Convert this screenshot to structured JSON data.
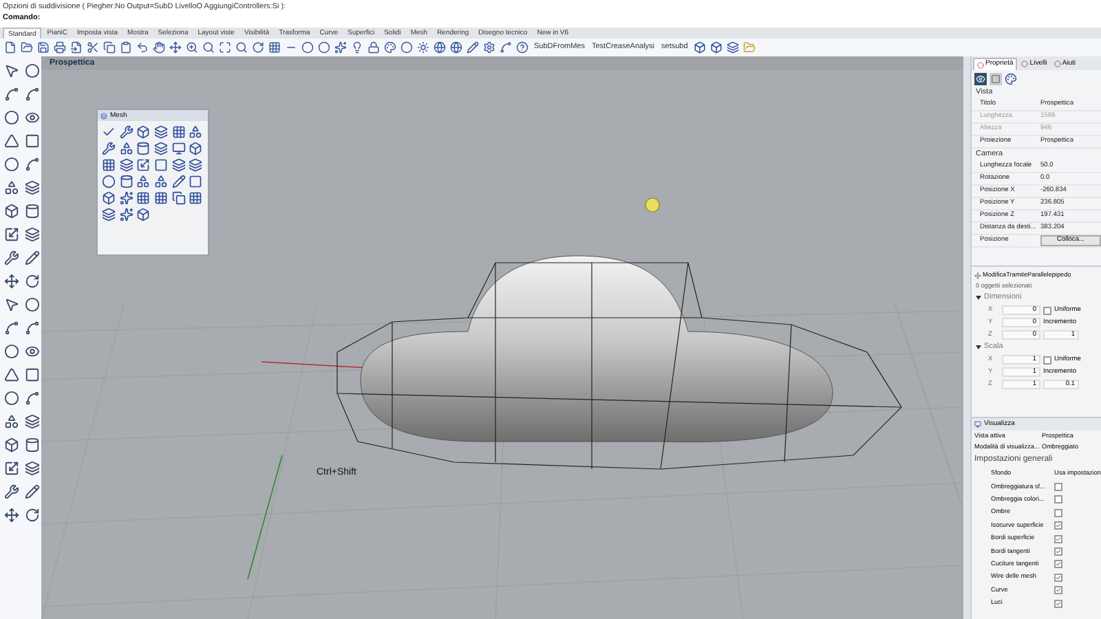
{
  "command_area": {
    "lines": [
      "Opzioni di suddivisione ( Piegher:No  Output=SubD  LivelloO  AggiungiControllers:Si ):"
    ],
    "prompt": "Comando:"
  },
  "toolbar_tabs": [
    {
      "label": "Standard",
      "selected": true
    },
    {
      "label": "PianiC",
      "selected": false
    },
    {
      "label": "Imposta vista",
      "selected": false
    },
    {
      "label": "Mostra",
      "selected": false
    },
    {
      "label": "Seleziona",
      "selected": false
    },
    {
      "label": "Layout viste",
      "selected": false
    },
    {
      "label": "Visibilità",
      "selected": false
    },
    {
      "label": "Trasforma",
      "selected": false
    },
    {
      "label": "Curve",
      "selected": false
    },
    {
      "label": "Superfici",
      "selected": false
    },
    {
      "label": "Solidi",
      "selected": false
    },
    {
      "label": "Mesh",
      "selected": false
    },
    {
      "label": "Rendering",
      "selected": false
    },
    {
      "label": "Disegno tecnico",
      "selected": false
    },
    {
      "label": "New in V6",
      "selected": false
    }
  ],
  "toolbar_buttons": [
    "SubDFromMes",
    "TestCreaseAnalysi",
    "setsubd"
  ],
  "viewport": {
    "title": "Prospettica",
    "caption": "Ctrl+Shift"
  },
  "mesh_panel": {
    "title": "Mesh"
  },
  "panel_tabs": [
    {
      "label": "Proprietà",
      "selected": true
    },
    {
      "label": "Livelli",
      "selected": false
    },
    {
      "label": "Aiuti",
      "selected": false
    }
  ],
  "properties": [
    {
      "title": "Vista",
      "rows": [
        {
          "label": "Titolo",
          "value": "Prospettica",
          "kind": "text",
          "disabled": false
        },
        {
          "label": "Lunghezza",
          "value": "1569",
          "kind": "text",
          "disabled": true
        },
        {
          "label": "Altezza",
          "value": "946",
          "kind": "text",
          "disabled": true
        },
        {
          "label": "Proiezione",
          "value": "Prospettica",
          "kind": "text",
          "disabled": false
        }
      ]
    },
    {
      "title": "Camera",
      "rows": [
        {
          "label": "Lunghezza focale",
          "value": "50.0",
          "kind": "text",
          "disabled": false
        },
        {
          "label": "Rotazione",
          "value": "0.0",
          "kind": "text",
          "disabled": false
        },
        {
          "label": "Posizione X",
          "value": "-260.834",
          "kind": "text",
          "disabled": false
        },
        {
          "label": "Posizione Y",
          "value": "236.805",
          "kind": "text",
          "disabled": false
        },
        {
          "label": "Posizione Z",
          "value": "197.431",
          "kind": "text",
          "disabled": false
        },
        {
          "label": "Distanza da desti...",
          "value": "383.204",
          "kind": "text",
          "disabled": false
        },
        {
          "label": "Posizione",
          "value": "Colloca...",
          "kind": "button",
          "disabled": false
        }
      ]
    }
  ],
  "box_edit": {
    "title": "ModificaTramiteParallelepipedo",
    "status": "0 oggetti selezionati",
    "groups": [
      {
        "title": "Dimensioni",
        "expanded": true,
        "rows": [
          {
            "axis": "X",
            "value": "0",
            "kind": "checkbox",
            "extra": "Uniforme",
            "checked": false
          },
          {
            "axis": "Y",
            "value": "0",
            "kind": "label",
            "extra": "Incremento"
          },
          {
            "axis": "Z",
            "value": "0",
            "kind": "spin",
            "extra": "1"
          }
        ]
      },
      {
        "title": "Scala",
        "expanded": true,
        "rows": [
          {
            "axis": "X",
            "value": "1",
            "kind": "checkbox",
            "extra": "Uniforme",
            "checked": false
          },
          {
            "axis": "Y",
            "value": "1",
            "kind": "label",
            "extra": "Incremento"
          },
          {
            "axis": "Z",
            "value": "1",
            "kind": "spin",
            "extra": "0.1"
          }
        ]
      }
    ]
  },
  "display": {
    "title": "Visualizza",
    "rows": [
      {
        "label": "Vista attiva",
        "value": "Prospettica"
      },
      {
        "label": "Modalità di visualizza...",
        "value": "Ombreggiato"
      }
    ],
    "section": "Impostazioni generali",
    "settings": [
      {
        "label": "Sfondo",
        "kind": "text",
        "value": "Usa impostazion"
      },
      {
        "label": "Ombreggiatura sf...",
        "kind": "checkbox",
        "checked": false
      },
      {
        "label": "Ombreggia colori...",
        "kind": "checkbox",
        "checked": false
      },
      {
        "label": "Ombre",
        "kind": "checkbox",
        "checked": false
      },
      {
        "label": "Isocurve superficie",
        "kind": "checkbox",
        "checked": true
      },
      {
        "label": "Bordi superficie",
        "kind": "checkbox",
        "checked": true
      },
      {
        "label": "Bordi tangenti",
        "kind": "checkbox",
        "checked": true
      },
      {
        "label": "Cuciture tangenti",
        "kind": "checkbox",
        "checked": true
      },
      {
        "label": "Wire delle mesh",
        "kind": "checkbox",
        "checked": true
      },
      {
        "label": "Curve",
        "kind": "checkbox",
        "checked": true
      },
      {
        "label": "Luci",
        "kind": "checkbox",
        "checked": true
      }
    ]
  }
}
